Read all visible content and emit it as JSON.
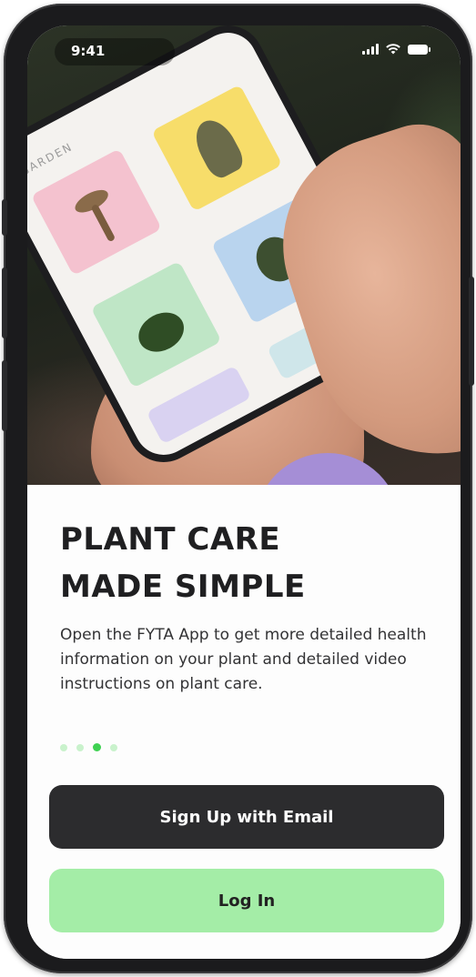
{
  "status_bar": {
    "time": "9:41",
    "icons": [
      "signal-icon",
      "wifi-icon",
      "battery-icon"
    ]
  },
  "hero": {
    "inner_app_title": "GARDEN"
  },
  "onboarding": {
    "headline_line1": "PLANT CARE",
    "headline_line2": "MADE SIMPLE",
    "description": "Open the FYTA App to get more detailed health information on your plant and detailed video instructions on plant care.",
    "pagination": {
      "total": 4,
      "active_index": 2
    }
  },
  "actions": {
    "signup_label": "Sign Up with Email",
    "login_label": "Log In"
  },
  "colors": {
    "primary_button": "#2c2c2e",
    "secondary_button": "#a4eda7",
    "dot_active": "#3fd152",
    "dot_inactive": "#c9f2cc"
  }
}
